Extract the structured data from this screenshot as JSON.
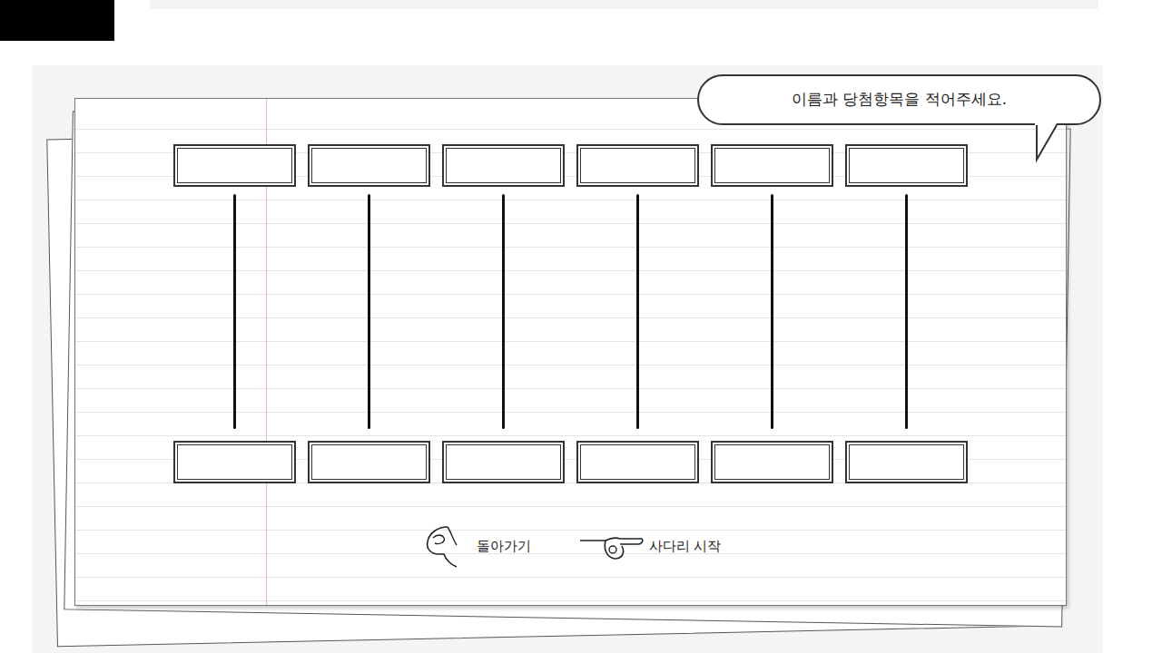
{
  "bubble": {
    "text": "이름과 당첨항목을 적어주세요."
  },
  "names": [
    {
      "value": ""
    },
    {
      "value": ""
    },
    {
      "value": ""
    },
    {
      "value": ""
    },
    {
      "value": ""
    },
    {
      "value": ""
    }
  ],
  "prizes": [
    {
      "value": ""
    },
    {
      "value": ""
    },
    {
      "value": ""
    },
    {
      "value": ""
    },
    {
      "value": ""
    },
    {
      "value": ""
    }
  ],
  "buttons": [
    {
      "label": "돌아가기"
    },
    {
      "label": "사다리 시작"
    }
  ]
}
